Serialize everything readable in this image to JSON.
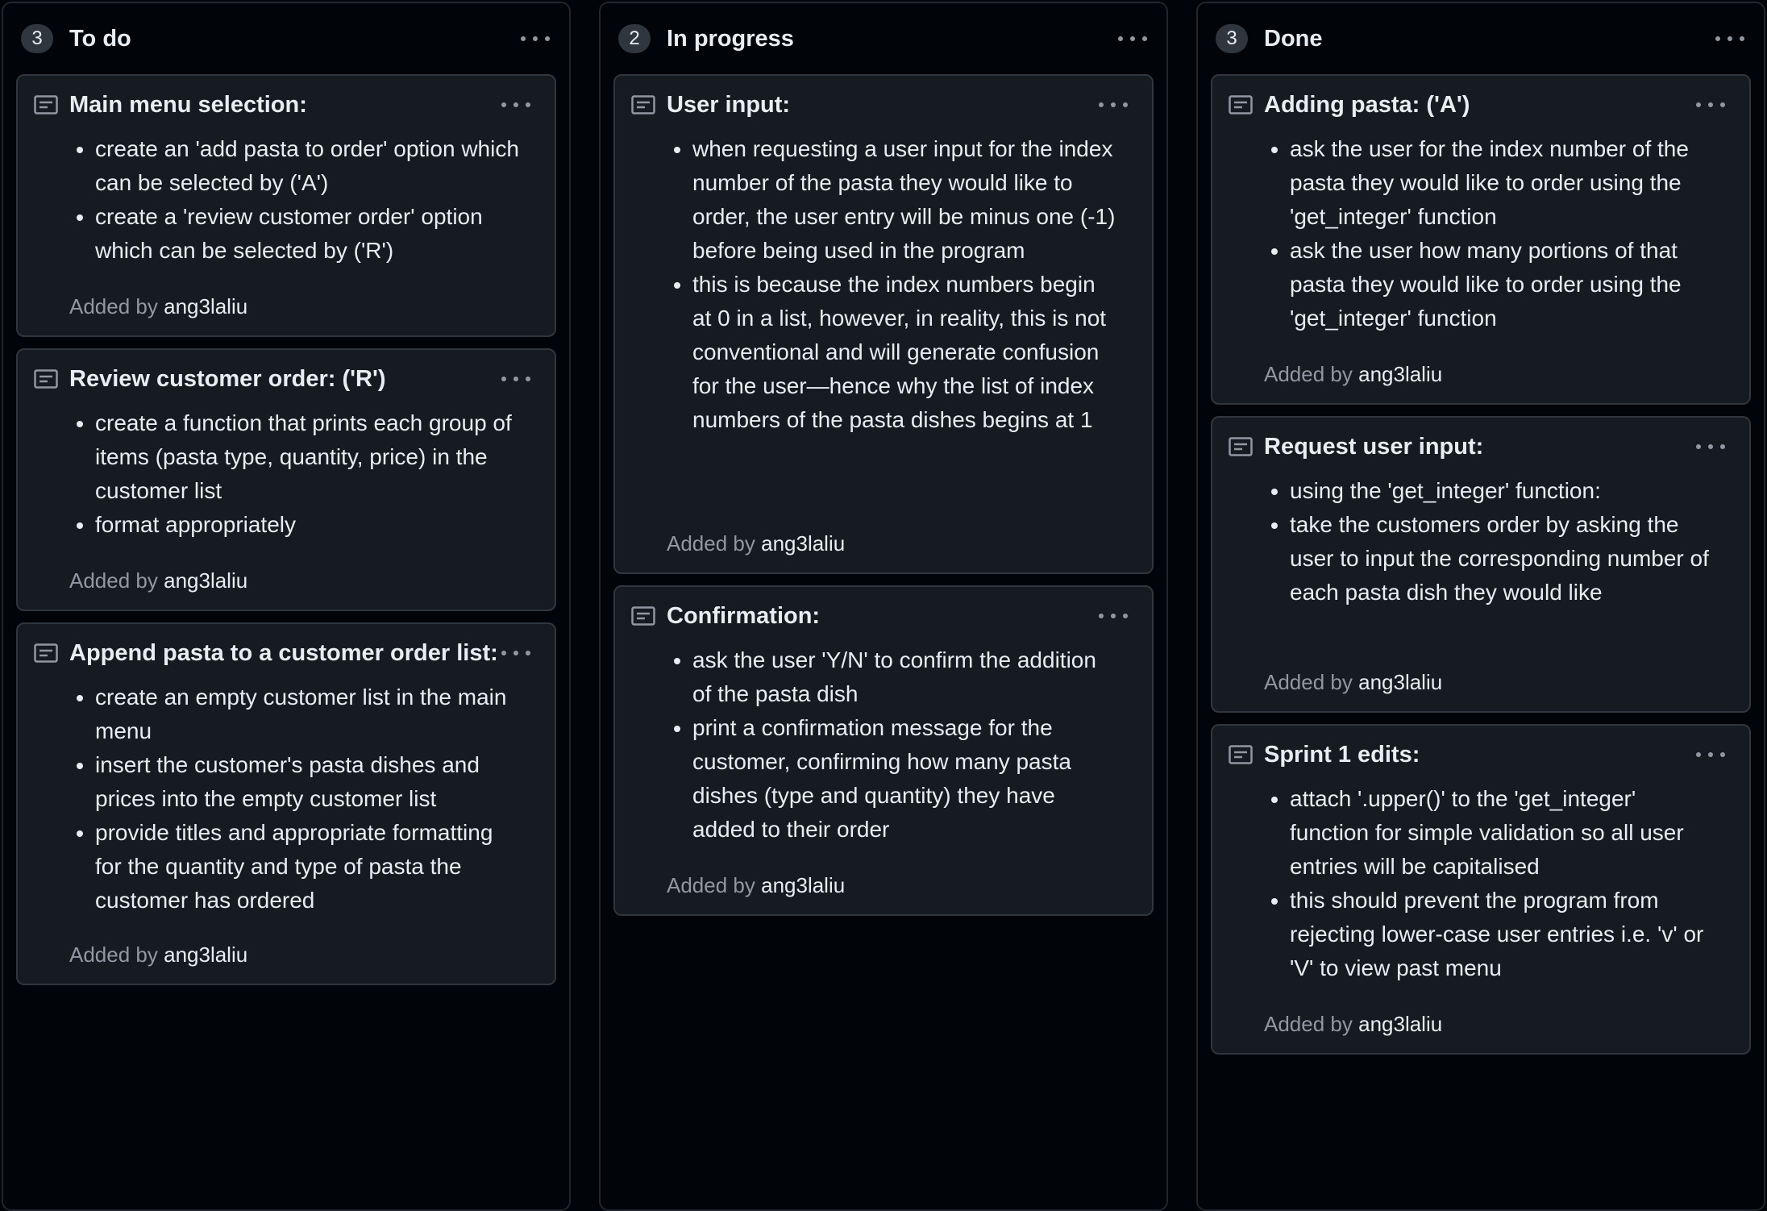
{
  "columns": [
    {
      "count": "3",
      "title": "To do",
      "cards": [
        {
          "title": "Main menu selection:",
          "items": [
            "create an 'add pasta to order' option which can be selected by ('A')",
            "create a 'review customer order' option which can be selected by ('R')"
          ],
          "added_by_label": "Added by",
          "author": "ang3laliu"
        },
        {
          "title": "Review customer order: ('R')",
          "items": [
            "create a function that prints each group of items (pasta type, quantity, price) in the customer list",
            "format appropriately"
          ],
          "added_by_label": "Added by",
          "author": "ang3laliu"
        },
        {
          "title": "Append pasta to a customer order list:",
          "items": [
            "create an empty customer list in the main menu",
            "insert the customer's pasta dishes and prices into the empty customer list",
            "provide titles and appropriate formatting for the quantity and type of pasta the customer has ordered"
          ],
          "added_by_label": "Added by",
          "author": "ang3laliu"
        }
      ]
    },
    {
      "count": "2",
      "title": "In progress",
      "cards": [
        {
          "title": "User input:",
          "items": [
            "when requesting a user input for the index number of the pasta they would like to order, the user entry will be minus one (-1) before being used in the program",
            "this is because the index numbers begin at 0 in a list, however, in reality, this is not conventional and will generate confusion for the user—hence why the list of index numbers of the pasta dishes begins at 1"
          ],
          "added_by_label": "Added by",
          "author": "ang3laliu"
        },
        {
          "title": "Confirmation:",
          "items": [
            "ask the user 'Y/N' to confirm the addition of the pasta dish",
            "print a confirmation message for the customer, confirming how many pasta dishes (type and quantity) they have added to their order"
          ],
          "added_by_label": "Added by",
          "author": "ang3laliu"
        }
      ]
    },
    {
      "count": "3",
      "title": "Done",
      "cards": [
        {
          "title": "Adding pasta: ('A')",
          "items": [
            "ask the user for the index number of the pasta they would like to order using the 'get_integer' function",
            "ask the user how many portions of that pasta they would like to order using the 'get_integer' function"
          ],
          "added_by_label": "Added by",
          "author": "ang3laliu"
        },
        {
          "title": "Request user input:",
          "items": [
            "using the 'get_integer' function:",
            "take the customers order by asking the user to input the corresponding number of each pasta dish they would like"
          ],
          "added_by_label": "Added by",
          "author": "ang3laliu"
        },
        {
          "title": "Sprint 1 edits:",
          "items": [
            "attach '.upper()' to the 'get_integer' function for simple validation so all user entries will be capitalised",
            "this should prevent the program from rejecting lower-case user entries i.e. 'v' or 'V' to view past menu"
          ],
          "added_by_label": "Added by",
          "author": "ang3laliu"
        }
      ]
    }
  ]
}
